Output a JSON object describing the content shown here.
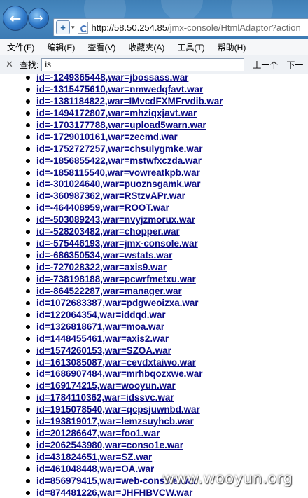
{
  "browser": {
    "url_host": "http://58.50.254.85",
    "url_path": "/jmx-console/HtmlAdaptor?action="
  },
  "menu": {
    "items": [
      "文件(F)",
      "编辑(E)",
      "查看(V)",
      "收藏夹(A)",
      "工具(T)",
      "帮助(H)"
    ]
  },
  "find": {
    "label": "查找:",
    "query": "is",
    "prev_label": "上一个",
    "next_label": "下一"
  },
  "mbeans": [
    "id=-1249365448,war=jbossass.war",
    "id=-1315475610,war=nmwedqfavt.war",
    "id=-1381184822,war=IMvcdFXMFrvdib.war",
    "id=-1494172807,war=mhziqxjavt.war",
    "id=-1703177788,war=upload5warn.war",
    "id=-1729010161,war=zecmd.war",
    "id=-1752727257,war=chsulygmke.war",
    "id=-1856855422,war=mstwfxczda.war",
    "id=-1858115540,war=vowreatkpb.war",
    "id=-301024640,war=puoznsgamk.war",
    "id=-360987362,war=RStzvAPr.war",
    "id=-464408959,war=ROOT.war",
    "id=-503089243,war=nvyjzmorux.war",
    "id=-528203482,war=chopper.war",
    "id=-575446193,war=jmx-console.war",
    "id=-686350534,war=wstats.war",
    "id=-727028322,war=axis9.war",
    "id=-738198188,war=pcwrfmetxu.war",
    "id=-864522287,war=manager.war",
    "id=1072683387,war=pdgweoizxa.war",
    "id=122064354,war=iddqd.war",
    "id=1326818671,war=moa.war",
    "id=1448455461,war=axis2.war",
    "id=1574260153,war=SZOA.war",
    "id=1613085087,war=cevdxtaiwo.war",
    "id=1686907484,war=mrhbqozxwe.war",
    "id=169174215,war=wooyun.war",
    "id=1784110362,war=idssvc.war",
    "id=1915078540,war=qcpsjuwnbd.war",
    "id=193819017,war=lemzsuyhcb.war",
    "id=201286647,war=foo1.war",
    "id=2062543980,war=conso1e.war",
    "id=431824651,war=SZ.war",
    "id=461048448,war=OA.war",
    "id=856979415,war=web-console.war",
    "id=874481226,war=JHFHBVCW.war"
  ],
  "watermark": "www.wooyun.org"
}
